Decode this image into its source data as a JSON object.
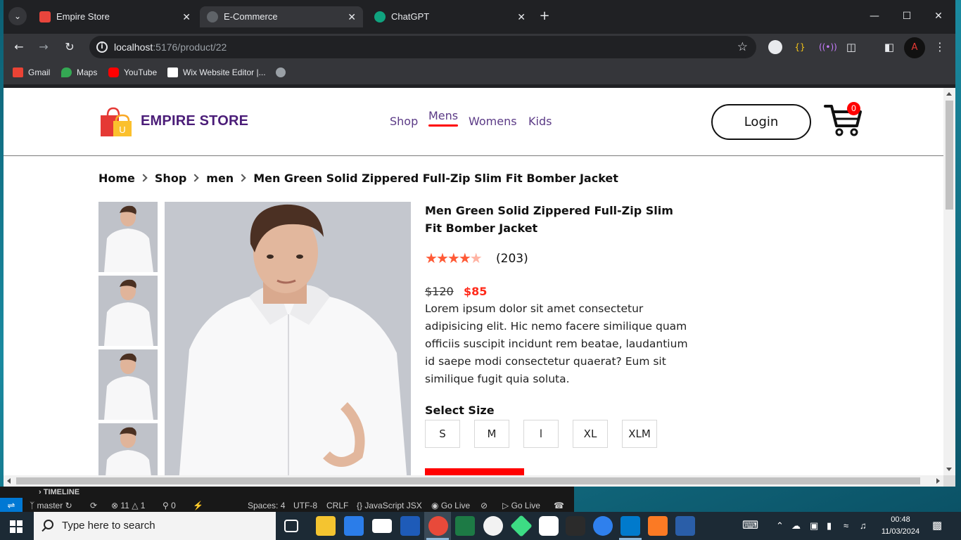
{
  "browser": {
    "tabs": [
      {
        "title": "Empire Store",
        "favicon_color": "#e8453c"
      },
      {
        "title": "E-Commerce",
        "favicon_color": "#9aa0a6"
      },
      {
        "title": "ChatGPT",
        "favicon_color": "#10a37f"
      }
    ],
    "url_host": "localhost",
    "url_path": ":5176/product/22",
    "bookmarks": [
      "Gmail",
      "Maps",
      "YouTube",
      "Wix Website Editor |..."
    ]
  },
  "site": {
    "brand": "EMPIRE STORE",
    "menu": [
      "Shop",
      "Mens",
      "Womens",
      "Kids"
    ],
    "active_menu": "Mens",
    "login_label": "Login",
    "cart_count": "0"
  },
  "breadcrumb": [
    "Home",
    "Shop",
    "men",
    "Men Green Solid Zippered Full-Zip Slim Fit Bomber Jacket"
  ],
  "product": {
    "title": "Men Green Solid Zippered Full-Zip Slim Fit Bomber Jacket",
    "rating": 4,
    "rating_max": 5,
    "review_count": "(203)",
    "old_price": "$120",
    "new_price": "$85",
    "description": "Lorem ipsum dolor sit amet consectetur adipisicing elit. Hic nemo facere similique quam officiis suscipit incidunt rem beatae, laudantium id saepe modi consectetur quaerat? Eum sit similique fugit quia soluta.",
    "size_label": "Select Size",
    "sizes": [
      "S",
      "M",
      "l",
      "XL",
      "XLM"
    ]
  },
  "vscode": {
    "panel_title": "TIMELINE",
    "branch": "master",
    "errors": "11",
    "warnings": "1",
    "ports": "0",
    "spaces": "Spaces: 4",
    "encoding": "UTF-8",
    "eol": "CRLF",
    "language": "JavaScript JSX",
    "golive1": "Go Live",
    "golive2": "Go Live"
  },
  "taskbar": {
    "search_placeholder": "Type here to search",
    "time": "00:48",
    "date": "11/03/2024"
  }
}
